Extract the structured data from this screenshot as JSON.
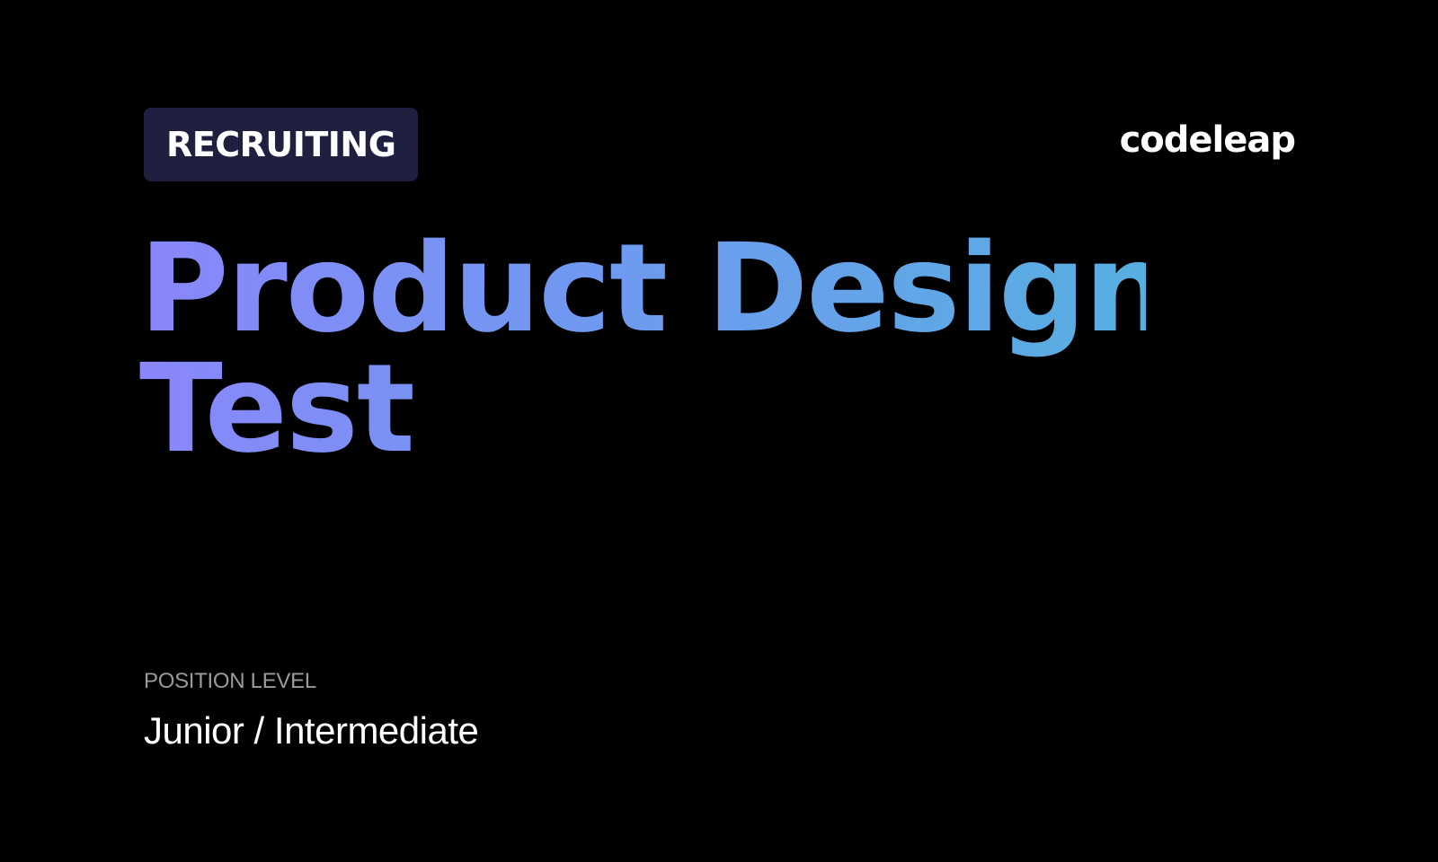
{
  "badge": {
    "label": "RECRUITING",
    "background_color": "#1f2040"
  },
  "logo": {
    "text": "codeleap"
  },
  "title": {
    "line1": "Product Design",
    "line2": "Test",
    "gradient_colors": [
      "#8a86fb",
      "#6f99f0",
      "#57afe0"
    ]
  },
  "position_level": {
    "label": "POSITION LEVEL",
    "value": "Junior / Intermediate"
  },
  "colors": {
    "background": "#000000",
    "text": "#ffffff",
    "muted_text": "#9a9a9a"
  }
}
